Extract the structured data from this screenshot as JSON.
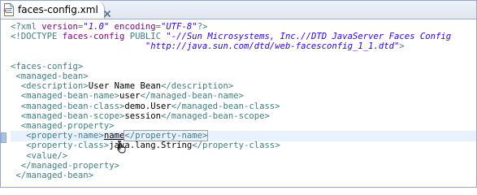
{
  "tab": {
    "title": "faces-config.xml",
    "icon": "xml-file-icon",
    "close_icon": "close-icon"
  },
  "editor": {
    "lines": [
      {
        "parts": [
          [
            "pi",
            "<?xml "
          ],
          [
            "attr",
            "version"
          ],
          [
            "pi",
            "="
          ],
          [
            "val",
            "\"1.0\""
          ],
          [
            "pi",
            " "
          ],
          [
            "attr",
            "encoding"
          ],
          [
            "pi",
            "="
          ],
          [
            "val",
            "\"UTF-8\""
          ],
          [
            "pi",
            "?>"
          ]
        ]
      },
      {
        "parts": [
          [
            "tag",
            "<!DOCTYPE "
          ],
          [
            "attr",
            "faces-config "
          ],
          [
            "keyword",
            "PUBLIC "
          ],
          [
            "val",
            "\"-//Sun Microsystems, Inc.//DTD JavaServer Faces Config"
          ]
        ]
      },
      {
        "parts": [
          [
            "text",
            "                          "
          ],
          [
            "val",
            "\"http://java.sun.com/dtd/web-facesconfig_1_1.dtd\""
          ],
          [
            "tag",
            ">"
          ]
        ]
      },
      {
        "parts": []
      },
      {
        "parts": [
          [
            "tag",
            "<faces-config>"
          ]
        ]
      },
      {
        "parts": [
          [
            "text",
            " "
          ],
          [
            "tag",
            "<managed-bean>"
          ]
        ]
      },
      {
        "parts": [
          [
            "text",
            "  "
          ],
          [
            "tag",
            "<description>"
          ],
          [
            "text",
            "User Name Bean"
          ],
          [
            "tag",
            "</description>"
          ]
        ]
      },
      {
        "parts": [
          [
            "text",
            "  "
          ],
          [
            "tag",
            "<managed-bean-name>"
          ],
          [
            "text",
            "user"
          ],
          [
            "tag",
            "</managed-bean-name>"
          ]
        ]
      },
      {
        "parts": [
          [
            "text",
            "  "
          ],
          [
            "tag",
            "<managed-bean-class>"
          ],
          [
            "text",
            "demo.User"
          ],
          [
            "tag",
            "</managed-bean-class>"
          ]
        ]
      },
      {
        "parts": [
          [
            "text",
            "  "
          ],
          [
            "tag",
            "<managed-bean-scope>"
          ],
          [
            "text",
            "session"
          ],
          [
            "tag",
            "</managed-bean-scope>"
          ]
        ]
      },
      {
        "parts": [
          [
            "text",
            "  "
          ],
          [
            "tag",
            "<managed-property>"
          ]
        ]
      },
      {
        "parts": [
          [
            "text",
            "   "
          ],
          [
            "tag",
            "<property-name>"
          ],
          [
            "under",
            "name"
          ],
          [
            "tag",
            "</property-name>"
          ]
        ],
        "current": true
      },
      {
        "parts": [
          [
            "text",
            "   "
          ],
          [
            "tag",
            "<property-class>"
          ],
          [
            "text",
            "java.lang.String"
          ],
          [
            "tag",
            "</property-class>"
          ]
        ]
      },
      {
        "parts": [
          [
            "text",
            "   "
          ],
          [
            "tag",
            "<value/>"
          ]
        ]
      },
      {
        "parts": [
          [
            "text",
            "  "
          ],
          [
            "tag",
            "</managed-property>"
          ]
        ]
      },
      {
        "parts": [
          [
            "text",
            " "
          ],
          [
            "tag",
            "</managed-bean>"
          ]
        ]
      }
    ],
    "current_line_index": 11
  },
  "colors": {
    "tag": "#3f7f7f",
    "attr": "#7f007f",
    "value": "#2a00ff",
    "current_line": "#e8f2fe",
    "marker": "#a9c2e4"
  },
  "cursor_icon": "text-cursor-hand-icon"
}
